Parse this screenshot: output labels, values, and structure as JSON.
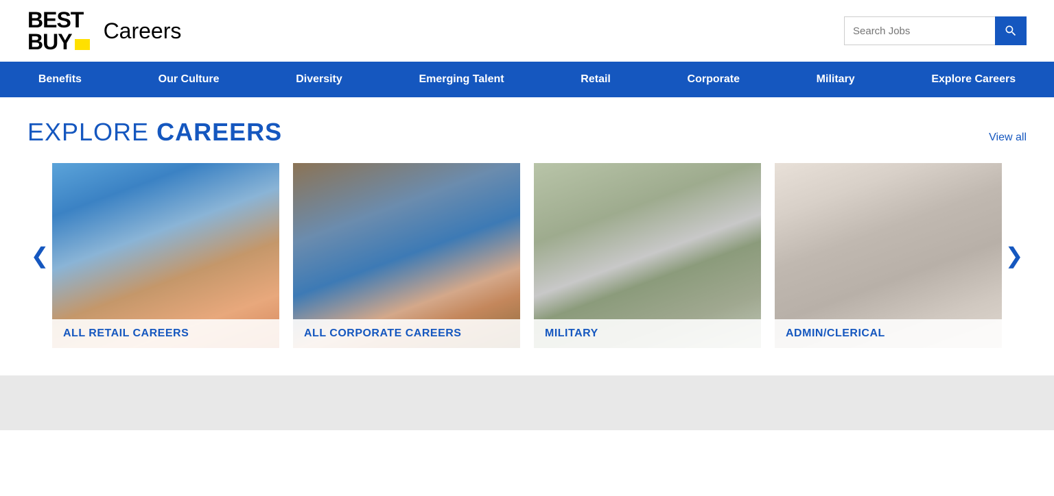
{
  "header": {
    "logo_best": "BEST",
    "logo_buy": "BUY",
    "logo_careers": "Careers",
    "search_placeholder": "Search Jobs"
  },
  "nav": {
    "items": [
      {
        "label": "Benefits",
        "id": "benefits"
      },
      {
        "label": "Our Culture",
        "id": "our-culture"
      },
      {
        "label": "Diversity",
        "id": "diversity"
      },
      {
        "label": "Emerging Talent",
        "id": "emerging-talent"
      },
      {
        "label": "Retail",
        "id": "retail"
      },
      {
        "label": "Corporate",
        "id": "corporate"
      },
      {
        "label": "Military",
        "id": "military"
      },
      {
        "label": "Explore Careers",
        "id": "explore-careers"
      }
    ]
  },
  "explore": {
    "title_light": "EXPLORE ",
    "title_bold": "CAREERS",
    "view_all": "View all",
    "cards": [
      {
        "id": "retail",
        "label": "ALL RETAIL CAREERS",
        "img_class": "card-img-retail"
      },
      {
        "id": "corporate",
        "label": "ALL CORPORATE CAREERS",
        "img_class": "card-img-corporate"
      },
      {
        "id": "military",
        "label": "MILITARY",
        "img_class": "card-img-military"
      },
      {
        "id": "admin",
        "label": "ADMIN/CLERICAL",
        "img_class": "card-img-admin"
      }
    ],
    "prev_arrow": "❮",
    "next_arrow": "❯"
  }
}
